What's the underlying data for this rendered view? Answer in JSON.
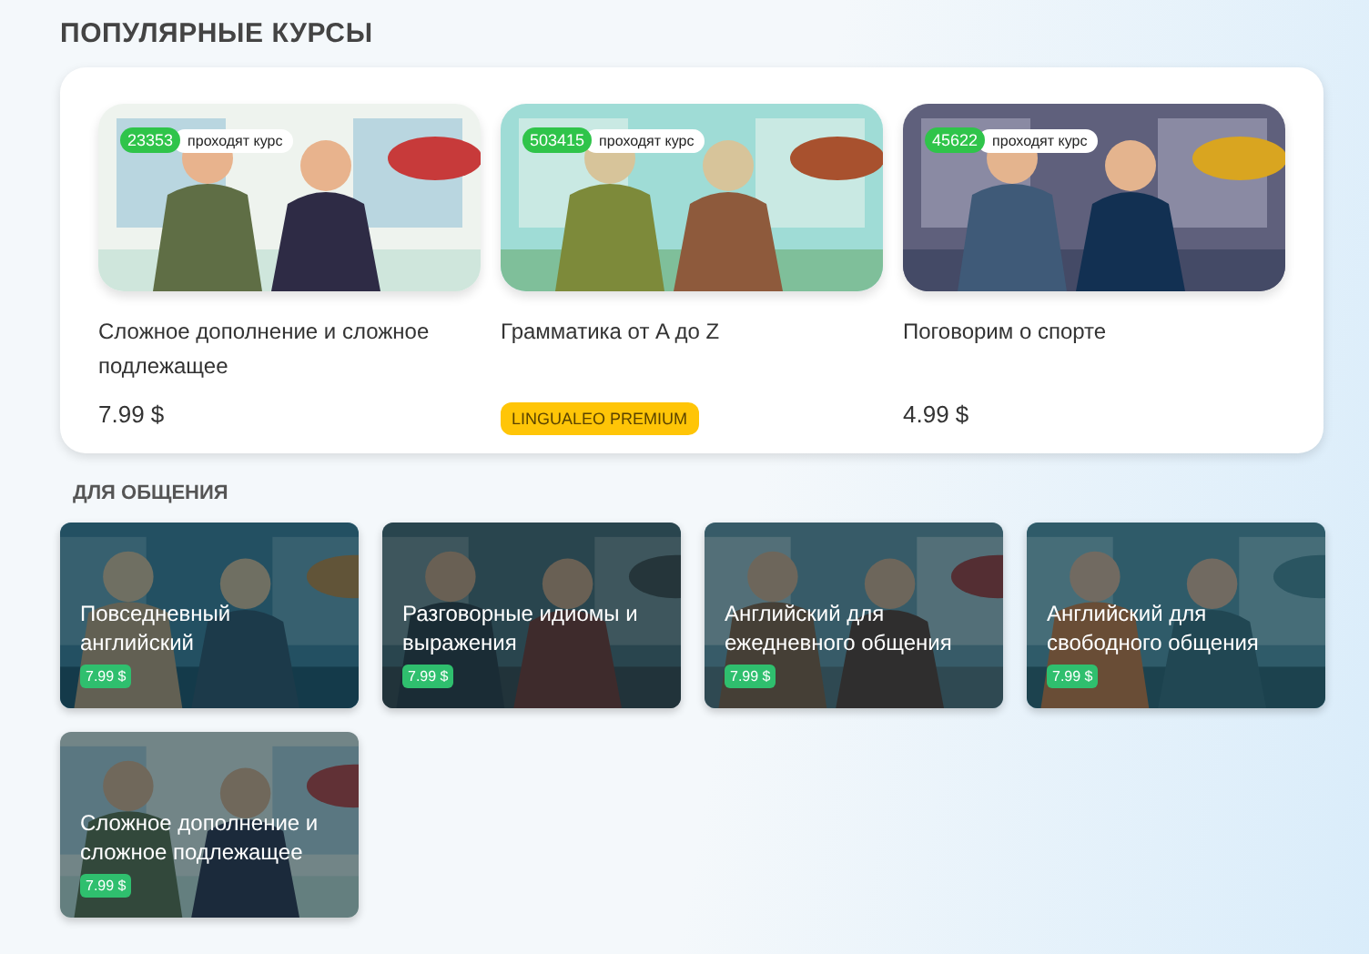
{
  "popular": {
    "heading": "ПОПУЛЯРНЫЕ КУРСЫ",
    "courses": [
      {
        "title": "Сложное дополнение и сложное подлежащее",
        "learners": "23353",
        "learners_label": "проходят курс",
        "kind": "price",
        "price": "7.99 $"
      },
      {
        "title": "Грамматика от A до Z",
        "learners": "503415",
        "learners_label": "проходят курс",
        "kind": "premium",
        "badge": "LINGUALEO PREMIUM"
      },
      {
        "title": "Поговорим о спорте",
        "learners": "45622",
        "learners_label": "проходят курс",
        "kind": "price",
        "price": "4.99 $"
      }
    ]
  },
  "communication": {
    "heading": "ДЛЯ ОБЩЕНИЯ",
    "courses": [
      {
        "title": "Повседневный английский",
        "price": "7.99 $"
      },
      {
        "title": "Разговорные идиомы и выражения",
        "price": "7.99 $"
      },
      {
        "title": "Английский для ежедневного общения",
        "price": "7.99 $"
      },
      {
        "title": "Английский для свободного общения",
        "price": "7.99 $"
      },
      {
        "title": "Сложное дополнение и сложное подлежащее",
        "price": "7.99 $"
      }
    ]
  }
}
